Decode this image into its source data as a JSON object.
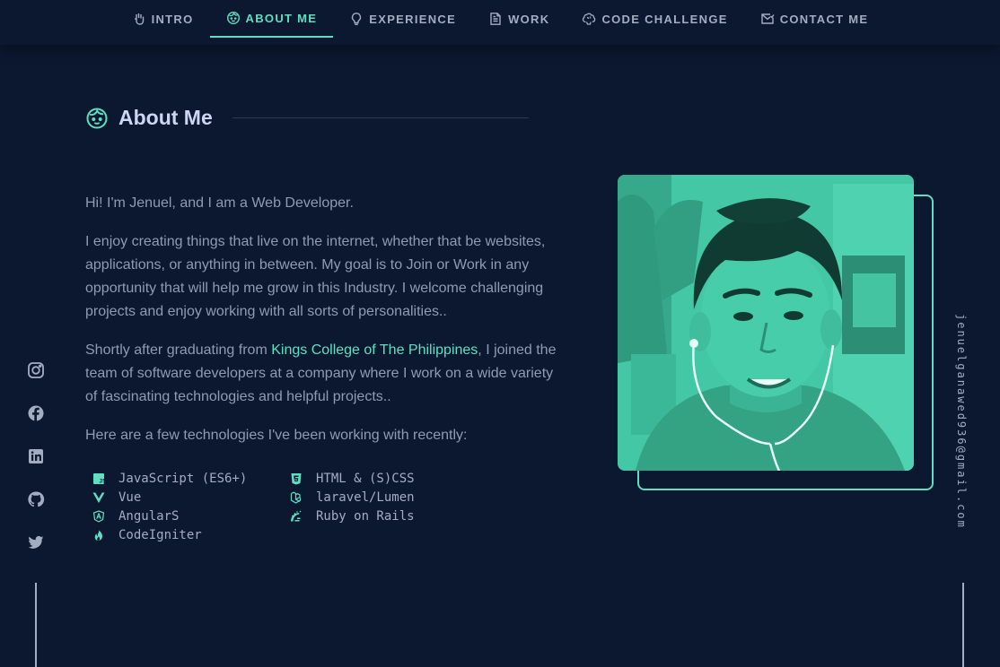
{
  "nav": {
    "items": [
      {
        "label": "Intro",
        "icon": "hand-icon"
      },
      {
        "label": "About Me",
        "icon": "face-icon"
      },
      {
        "label": "Experience",
        "icon": "bulb-icon"
      },
      {
        "label": "Work",
        "icon": "document-icon"
      },
      {
        "label": "Code Challenge",
        "icon": "brain-icon"
      },
      {
        "label": "Contact Me",
        "icon": "mail-icon"
      }
    ],
    "active_label": "About Me"
  },
  "section": {
    "title": "About Me",
    "icon": "face-icon"
  },
  "about": {
    "intro": "Hi! I'm Jenuel, and I am a Web Developer.",
    "p2": "I enjoy creating things that live on the internet, whether that be websites, applications, or anything in between. My goal is to Join or Work in any opportunity that will help me grow in this Industry. I welcome challenging projects and enjoy working with all sorts of personalities..",
    "p3_before": "Shortly after graduating from ",
    "p3_link": "Kings College of The Philippines",
    "p3_after": ", I joined the team of software developers at a company where I work on a wide variety of fascinating technologies and helpful projects..",
    "p4": "Here are a few technologies I've been working with recently:"
  },
  "technologies": [
    {
      "label": "JavaScript (ES6+)",
      "icon": "javascript-icon"
    },
    {
      "label": "HTML & (S)CSS",
      "icon": "html5-icon"
    },
    {
      "label": "Vue",
      "icon": "vue-icon"
    },
    {
      "label": "laravel/Lumen",
      "icon": "laravel-icon"
    },
    {
      "label": "AngularS",
      "icon": "angular-icon"
    },
    {
      "label": "Ruby on Rails",
      "icon": "rails-icon"
    },
    {
      "label": "CodeIgniter",
      "icon": "codeigniter-icon"
    }
  ],
  "social": [
    "instagram-icon",
    "facebook-icon",
    "linkedin-icon",
    "github-icon",
    "twitter-icon"
  ],
  "email": "jenuelganawed936@gmail.com",
  "colors": {
    "background": "#0b1830",
    "accent": "#5ce0c1",
    "text": "#8f9bb3",
    "heading": "#cdd6f2"
  }
}
